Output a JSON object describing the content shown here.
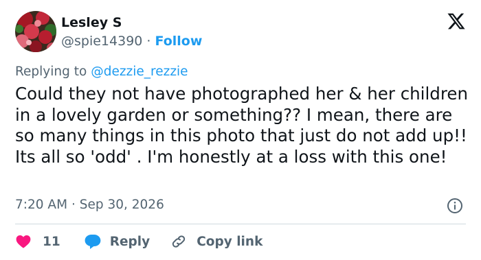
{
  "author": {
    "name": "Lesley S",
    "handle": "@spie14390",
    "separator": "·",
    "follow_label": "Follow"
  },
  "reply_context": {
    "prefix": "Replying to",
    "to": "@dezzie_rezzie"
  },
  "tweet": {
    "text": "Could they not have photographed her & her children in a lovely garden or something?? I mean, there are so many things in this photo that just do not add up!! Its all so 'odd' . I'm honestly at a loss with this one!",
    "time": "7:20 AM",
    "date": "Sep 30, 2026"
  },
  "actions": {
    "like_count": "11",
    "reply_label": "Reply",
    "copy_link_label": "Copy link"
  },
  "icons": {
    "x": "x-logo-icon",
    "info": "info-icon",
    "like": "heart-icon",
    "reply": "speech-bubble-icon",
    "copy_link": "link-icon"
  },
  "colors": {
    "accent": "#1d9bf0",
    "like": "#f91880",
    "secondary_text": "#536471",
    "text": "#0f1419",
    "divider": "#cfd9de"
  }
}
